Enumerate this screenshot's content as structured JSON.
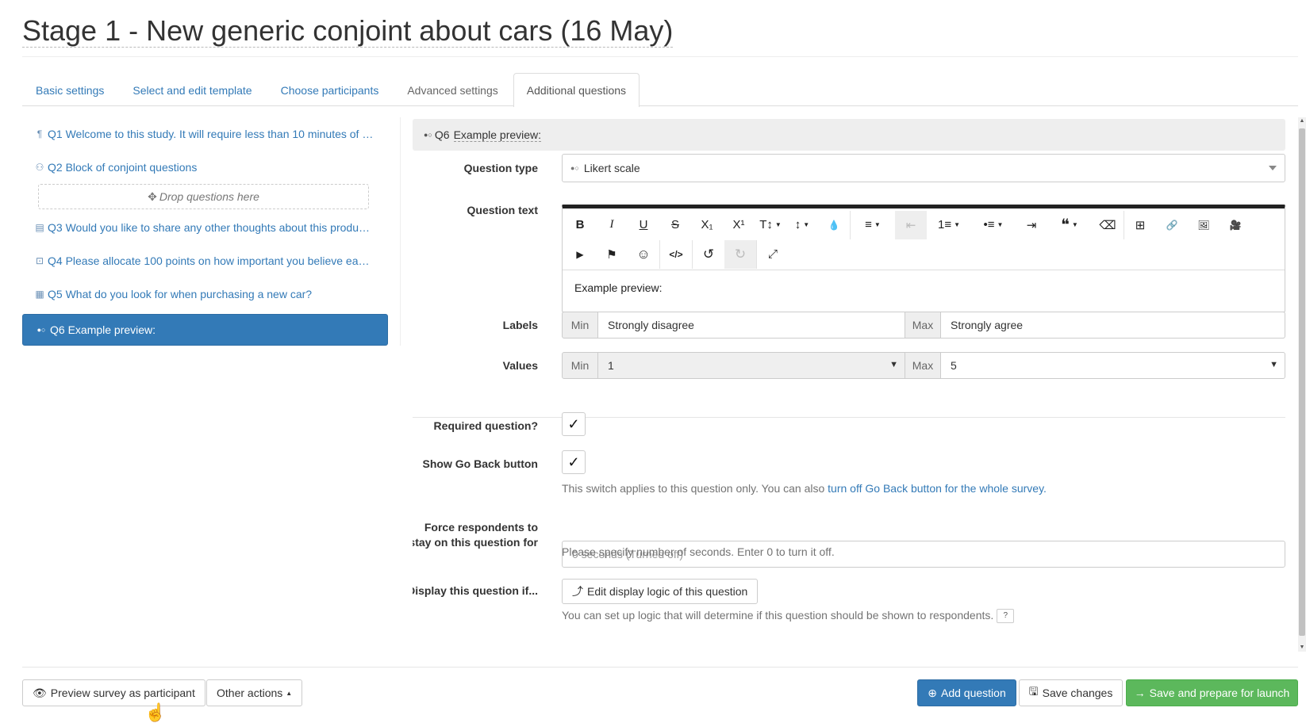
{
  "page": {
    "title": "Stage 1 - New generic conjoint about cars (16 May)"
  },
  "tabs": [
    {
      "label": "Basic settings"
    },
    {
      "label": "Select and edit template"
    },
    {
      "label": "Choose participants"
    },
    {
      "label": "Advanced settings"
    },
    {
      "label": "Additional questions"
    }
  ],
  "questions": [
    {
      "icon": "¶",
      "text": "Q1 Welcome to this study. It will require less than 10 minutes of …"
    },
    {
      "icon": "⚇",
      "text": "Q2 Block of conjoint questions"
    },
    {
      "icon": "▤",
      "text": "Q3 Would you like to share any other thoughts about this produ…"
    },
    {
      "icon": "⊡",
      "text": "Q4 Please allocate 100 points on how important you believe ea…"
    },
    {
      "icon": "▦",
      "text": "Q5 What do you look for when purchasing a new car?"
    },
    {
      "icon": "●○",
      "text": "Q6 Example preview:"
    }
  ],
  "dropzone": {
    "icon": "✥",
    "label": "Drop questions here"
  },
  "editor_panel": {
    "header": {
      "icon": "●○",
      "number": "Q6",
      "text": "Example preview:"
    },
    "question_type": {
      "label": "Question type",
      "value": "Likert scale",
      "icon": "●○"
    },
    "question_text": {
      "label": "Question text",
      "content": "Example preview:"
    },
    "toolbar": {
      "row1": [
        "B",
        "I",
        "U",
        "S",
        "X₁",
        "X¹",
        "T↕",
        "↕",
        "💧",
        "≡",
        "⇤",
        "1≡",
        "•≡",
        "⇥",
        "❝",
        "⌫",
        "⊞",
        "🔗",
        "🖼",
        "🎥"
      ],
      "row2": [
        "▶",
        "⚑",
        "☺",
        "</>",
        "↺",
        "↻",
        "⤢"
      ]
    },
    "labels": {
      "label": "Labels",
      "min_addon": "Min",
      "min_value": "Strongly disagree",
      "max_addon": "Max",
      "max_value": "Strongly agree"
    },
    "values": {
      "label": "Values",
      "min_addon": "Min",
      "min_value": "1",
      "max_addon": "Max",
      "max_value": "5"
    },
    "required": {
      "label": "Required question?",
      "check": "✓"
    },
    "go_back": {
      "label": "Show Go Back button",
      "check": "✓",
      "help_prefix": "This switch applies to this question only. You can also ",
      "help_link": "turn off Go Back button for the whole survey."
    },
    "force_stay": {
      "label": "Force respondents to stay on this question for",
      "placeholder": "0 seconds (Turned off)",
      "help": "Please specify number of seconds. Enter 0 to turn it off."
    },
    "display_logic": {
      "label": "Display this question if...",
      "button": "Edit display logic of this question",
      "help": "You can set up logic that will determine if this question should be shown to respondents.",
      "help_icon": "?"
    }
  },
  "footer": {
    "preview": "Preview survey as participant",
    "other": "Other actions",
    "add": "Add question",
    "save": "Save changes",
    "launch": "Save and prepare for launch"
  }
}
